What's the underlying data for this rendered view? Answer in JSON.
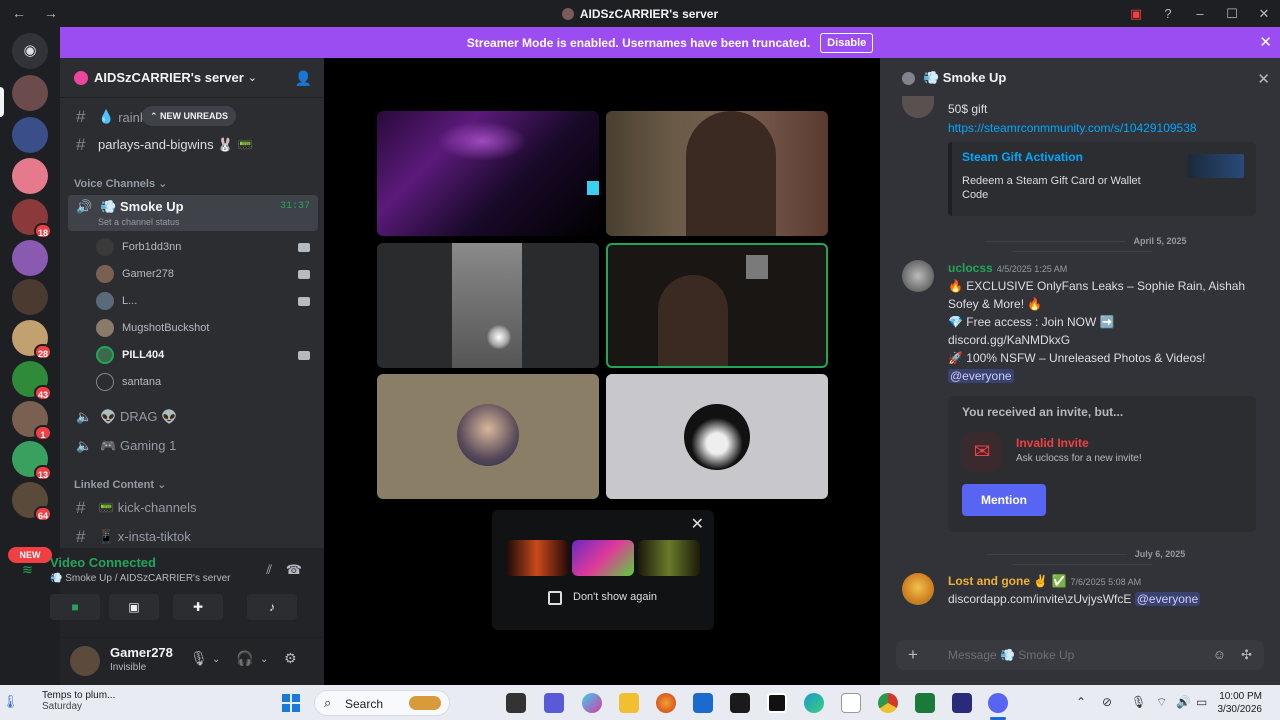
{
  "window": {
    "title": "AIDSzCARRIER's server",
    "nav_back": "←",
    "nav_forward": "→"
  },
  "banner": {
    "message": "Streamer Mode is enabled. Usernames have been truncated.",
    "button": "Disable"
  },
  "server_rail": {
    "badges": [
      "18",
      "28",
      "43",
      "1",
      "13",
      "64"
    ],
    "new_label": "NEW"
  },
  "sidebar": {
    "server_name": "AIDSzCARRIER's server",
    "new_unreads": "NEW UNREADS",
    "text_channels": [
      {
        "name": "raink"
      },
      {
        "name": "parlays-and-bigwins 🐰 📟"
      }
    ],
    "voice_category": "Voice Channels",
    "active_voice": {
      "name": "💨 Smoke Up",
      "timer": "31:37",
      "status": "Set a channel status"
    },
    "voice_users": [
      {
        "name": "Forb1dd3nn"
      },
      {
        "name": "Gamer278"
      },
      {
        "name": "L..."
      },
      {
        "name": "MugshotBuckshot"
      },
      {
        "name": "PILL404"
      },
      {
        "name": "santana"
      }
    ],
    "other_voice": [
      {
        "name": "👽 DRAG 👽"
      },
      {
        "name": "🎮 Gaming 1"
      }
    ],
    "linked_category": "Linked Content",
    "linked_channels": [
      {
        "name": "📟 kick-channels"
      },
      {
        "name": "📱 x-insta-tiktok"
      }
    ]
  },
  "voice_panel": {
    "status": "Video Connected",
    "location": "💨 Smoke Up / AIDSzCARRIER's server"
  },
  "user_panel": {
    "username": "Gamer278",
    "status": "Invisible"
  },
  "popup": {
    "checkbox_label": "Don't show again"
  },
  "chat": {
    "channel": "💨 Smoke Up",
    "msg1_text": "50$ gift",
    "msg1_link": "https://steamrconmmunity.com/s/10429109538",
    "embed_title": "Steam Gift Activation",
    "embed_desc": "Redeem a Steam Gift Card or Wallet Code",
    "date1": "April 5, 2025",
    "msg2_user": "uclocss",
    "msg2_time": "4/5/2025 1:25 AM",
    "msg2_line1": "🔥 EXCLUSIVE OnlyFans Leaks – Sophie Rain, Aishah Sofey & More! 🔥",
    "msg2_line2": "💎 Free access : Join NOW ➡️",
    "msg2_line3": "discord.gg/KaNMDkxG",
    "msg2_line4": "🚀 100% NSFW – Unreleased Photos & Videos!",
    "msg2_mention": "@everyone",
    "invite_header": "You received an invite, but...",
    "invite_title": "Invalid Invite",
    "invite_sub": "Ask uclocss for a new invite!",
    "invite_button": "Mention",
    "date2": "July 6, 2025",
    "msg3_user": "Lost and gone ✌️ ✅",
    "msg3_time": "7/6/2025 5:08 AM",
    "msg3_text": "discordapp.com/invite\\zUvjysWfcE",
    "msg3_mention": "@everyone",
    "input_placeholder": "Message 💨 Smoke Up"
  },
  "taskbar": {
    "weather_line1": "Temps to plum...",
    "weather_line2": "Saturday",
    "search": "Search",
    "time": "10:00 PM",
    "date": "3/30/2026"
  },
  "colors": {
    "banner": "#9b4df2",
    "accent": "#5865f2",
    "online": "#23a559",
    "link": "#00a8fc",
    "badge": "#f23f43"
  }
}
